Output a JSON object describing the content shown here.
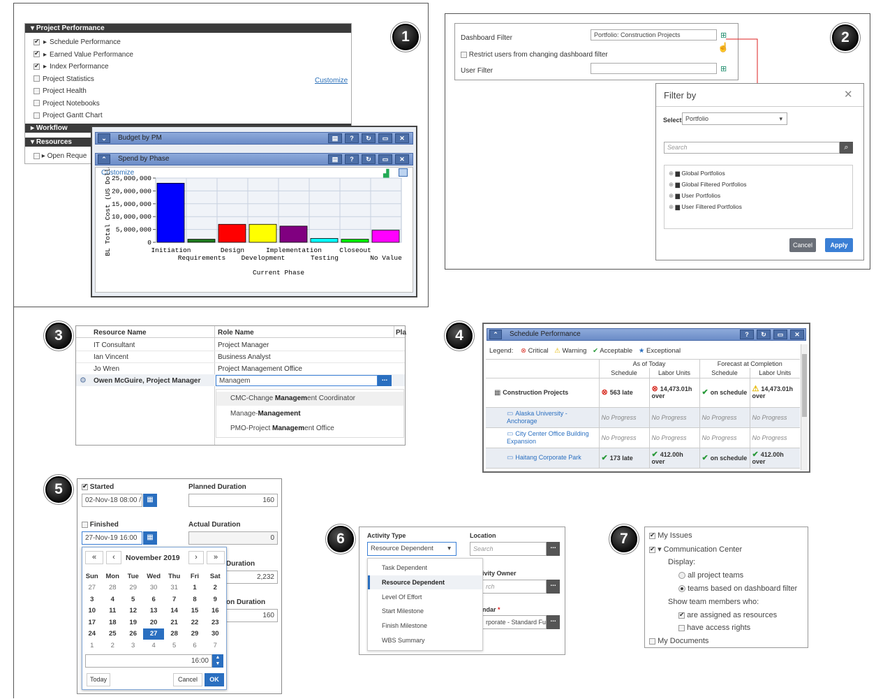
{
  "callouts": [
    "1",
    "2",
    "3",
    "4",
    "5",
    "6",
    "7"
  ],
  "panel1": {
    "project_performance": "Project Performance",
    "items": [
      {
        "label": "Schedule Performance",
        "checked": true,
        "arrow": true
      },
      {
        "label": "Earned Value Performance",
        "checked": true,
        "arrow": true
      },
      {
        "label": "Index Performance",
        "checked": true,
        "arrow": true
      },
      {
        "label": "Project Statistics",
        "checked": false,
        "arrow": false
      },
      {
        "label": "Project Health",
        "checked": false,
        "arrow": false
      },
      {
        "label": "Project Notebooks",
        "checked": false,
        "arrow": false
      },
      {
        "label": "Project Gantt Chart",
        "checked": false,
        "arrow": false
      }
    ],
    "customize": "Customize",
    "workflow": "Workflow",
    "resources": "Resources",
    "open_requests": "Open Reque",
    "budget_by_pm": "Budget by PM",
    "spend_by_phase": "Spend by Phase",
    "chart_customize": "Customize"
  },
  "chart_data": {
    "type": "bar",
    "title": "",
    "xlabel": "Current Phase",
    "ylabel": "BL Total Cost (US Dolla",
    "ylim": [
      0,
      25000000
    ],
    "yticks": [
      "25,000,000",
      "20,000,000",
      "15,000,000",
      "10,000,000",
      "5,000,000",
      "0"
    ],
    "categories": [
      "Initiation",
      "Requirements",
      "Design",
      "Development",
      "Implementation",
      "Testing",
      "Closeout",
      "No Value"
    ],
    "values": [
      23000000,
      1200000,
      7000000,
      7000000,
      6300000,
      1500000,
      1200000,
      4700000
    ],
    "colors": [
      "#0000ff",
      "#1e7a1e",
      "#ff0000",
      "#ffff00",
      "#800080",
      "#00ffff",
      "#00ff00",
      "#ff00ff"
    ]
  },
  "panel2": {
    "dashboard_filter_label": "Dashboard Filter",
    "dashboard_filter_value": "Portfolio: Construction Projects",
    "restrict_label": "Restrict users from changing dashboard filter",
    "user_filter_label": "User Filter",
    "dialog_title": "Filter by",
    "select_label": "Select",
    "select_value": "Portfolio",
    "search_placeholder": "Search",
    "tree": [
      "Global Portfolios",
      "Global Filtered Portfolios",
      "User Portfolios",
      "User Filtered Portfolios"
    ],
    "cancel": "Cancel",
    "apply": "Apply"
  },
  "panel3": {
    "col_resource": "Resource Name",
    "col_role": "Role Name",
    "col_pla": "Pla",
    "rows": [
      {
        "resource": "IT Consultant",
        "role": "Project Manager"
      },
      {
        "resource": "Ian Vincent",
        "role": "Business Analyst"
      },
      {
        "resource": "Jo Wren",
        "role": "Project Management Office"
      }
    ],
    "active_resource": "Owen McGuire, Project Manager",
    "active_input": "Managem",
    "more": "...",
    "suggestions": [
      {
        "pre": "CMC-Change ",
        "bold": "Managem",
        "post": "ent Coordinator"
      },
      {
        "pre": "Manage-",
        "bold": "Management",
        "post": ""
      },
      {
        "pre": "PMO-Project ",
        "bold": "Managem",
        "post": "ent Office"
      }
    ]
  },
  "panel4": {
    "title": "Schedule Performance",
    "legend_label": "Legend:",
    "legend": [
      "Critical",
      "Warning",
      "Acceptable",
      "Exceptional"
    ],
    "as_of_today": "As of Today",
    "forecast": "Forecast at Completion",
    "sub": [
      "Schedule",
      "Labor Units",
      "Schedule",
      "Labor Units"
    ],
    "rows": [
      {
        "name": "Construction Projects",
        "c1": "563 late",
        "c2": "14,473.01h over",
        "c3": "on schedule",
        "c4": "14,473.01h over"
      },
      {
        "name": "Alaska University - Anchorage",
        "c1": "No Progress",
        "c2": "No Progress",
        "c3": "No Progress",
        "c4": "No Progress"
      },
      {
        "name": "City Center Office Building Expansion",
        "c1": "No Progress",
        "c2": "No Progress",
        "c3": "No Progress",
        "c4": "No Progress"
      },
      {
        "name": "Haitang Corporate Park",
        "c1": "173 late",
        "c2": "412.00h over",
        "c3": "on schedule",
        "c4": "412.00h over"
      }
    ]
  },
  "panel5": {
    "started": "Started",
    "started_value": "02-Nov-18 08:00 /",
    "planned_duration": "Planned Duration",
    "planned_value": "160",
    "finished": "Finished",
    "finished_value": "27-Nov-19 16:00",
    "actual_duration": "Actual Duration",
    "actual_value": "0",
    "duration_partial": "Duration",
    "duration_value": "2,232",
    "on_duration_partial": "on Duration",
    "on_duration_value": "160",
    "month": "November 2019",
    "nav": [
      "«",
      "‹",
      "›",
      "»"
    ],
    "days": [
      "Sun",
      "Mon",
      "Tue",
      "Wed",
      "Thu",
      "Fri",
      "Sat"
    ],
    "weeks": [
      [
        "27",
        "28",
        "29",
        "30",
        "31",
        "1",
        "2"
      ],
      [
        "3",
        "4",
        "5",
        "6",
        "7",
        "8",
        "9"
      ],
      [
        "10",
        "11",
        "12",
        "13",
        "14",
        "15",
        "16"
      ],
      [
        "17",
        "18",
        "19",
        "20",
        "21",
        "22",
        "23"
      ],
      [
        "24",
        "25",
        "26",
        "27",
        "28",
        "29",
        "30"
      ],
      [
        "1",
        "2",
        "3",
        "4",
        "5",
        "6",
        "7"
      ]
    ],
    "time": "16:00",
    "today": "Today",
    "cancel": "Cancel",
    "ok": "OK"
  },
  "panel6": {
    "activity_type": "Activity Type",
    "activity_value": "Resource Dependent",
    "location": "Location",
    "search": "Search",
    "options": [
      "Task Dependent",
      "Resource Dependent",
      "Level Of Effort",
      "Start Milestone",
      "Finish Milestone",
      "WBS Summary"
    ],
    "owner_partial": "ivity Owner",
    "owner_value": "rch",
    "calendar_partial": "ndar",
    "calendar_value": "rporate - Standard Fu",
    "more": "..."
  },
  "panel7": {
    "my_issues": "My Issues",
    "comm_center": "Communication Center",
    "display": "Display:",
    "all_teams": "all project teams",
    "teams_filter": "teams based on dashboard filter",
    "show_members": "Show team members who:",
    "assigned": "are assigned as resources",
    "access": "have access rights",
    "my_documents": "My Documents"
  }
}
